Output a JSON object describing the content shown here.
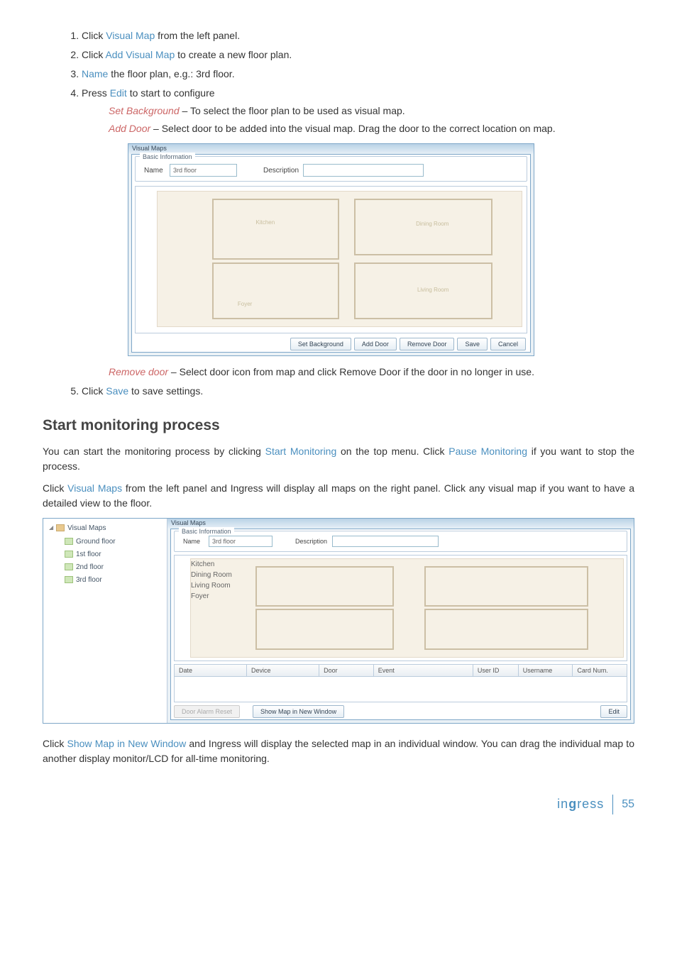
{
  "steps": {
    "s1_a": "Click ",
    "s1_link": "Visual Map",
    "s1_b": " from the left panel.",
    "s2_a": "Click ",
    "s2_link": "Add Visual Map",
    "s2_b": " to create a new floor plan.",
    "s3_link": "Name",
    "s3_b": " the floor plan, e.g.: 3rd floor.",
    "s4_a": "Press ",
    "s4_link": "Edit",
    "s4_b": " to start to configure",
    "s5_a": "Click ",
    "s5_link": "Save",
    "s5_b": " to save settings."
  },
  "subitems": {
    "setbg_lbl": "Set Background",
    "setbg_txt": " – To select the floor plan to be used as visual map.",
    "adddoor_lbl": "Add Door",
    "adddoor_txt": " – Select door to be added into the visual map. Drag the door to the correct location on map.",
    "removedoor_lbl": "Remove door",
    "removedoor_txt": " – Select door icon from map and click Remove Door if the door in no longer in use."
  },
  "shot1": {
    "title": "Visual Maps",
    "group": "Basic Information",
    "name_lbl": "Name",
    "name_val": "3rd floor",
    "desc_lbl": "Description",
    "rooms": {
      "kitchen": "Kitchen",
      "dining": "Dining Room",
      "living": "Living Room",
      "foyer": "Foyer"
    },
    "buttons": {
      "setbg": "Set Background",
      "add": "Add Door",
      "remove": "Remove Door",
      "save": "Save",
      "cancel": "Cancel"
    }
  },
  "section2": {
    "heading": "Start monitoring process",
    "p1_a": "You can start the monitoring process by clicking ",
    "p1_link1": "Start Monitoring",
    "p1_b": " on the top menu. Click ",
    "p1_link2": "Pause Monitoring",
    "p1_c": " if you want to stop the process.",
    "p2_a": "Click ",
    "p2_link": "Visual Maps",
    "p2_b": " from the left panel and Ingress will display all maps on the right panel. Click any visual map if you want to have a detailed view to the floor.",
    "p3_a": "Click ",
    "p3_link": "Show Map in New Window",
    "p3_b": " and Ingress will display the selected map in an individual window. You can drag the individual map to another display monitor/LCD for all-time monitoring."
  },
  "shot2": {
    "tree": {
      "root": "Visual Maps",
      "items": [
        "Ground floor",
        "1st floor",
        "2nd floor",
        "3rd floor"
      ]
    },
    "title": "Visual Maps",
    "group": "Basic Information",
    "name_lbl": "Name",
    "name_val": "3rd floor",
    "desc_lbl": "Description",
    "rooms": {
      "kitchen": "Kitchen",
      "dining": "Dining Room",
      "living": "Living Room",
      "foyer": "Foyer"
    },
    "table": {
      "c1": "Date",
      "c2": "Device",
      "c3": "Door",
      "c4": "Event",
      "c5": "User ID",
      "c6": "Username",
      "c7": "Card Num."
    },
    "buttons": {
      "reset": "Door Alarm Reset",
      "show": "Show Map in New Window",
      "edit": "Edit"
    }
  },
  "footer": {
    "brand_pre": "in",
    "brand_g": "g",
    "brand_post": "ress",
    "page": "55"
  }
}
